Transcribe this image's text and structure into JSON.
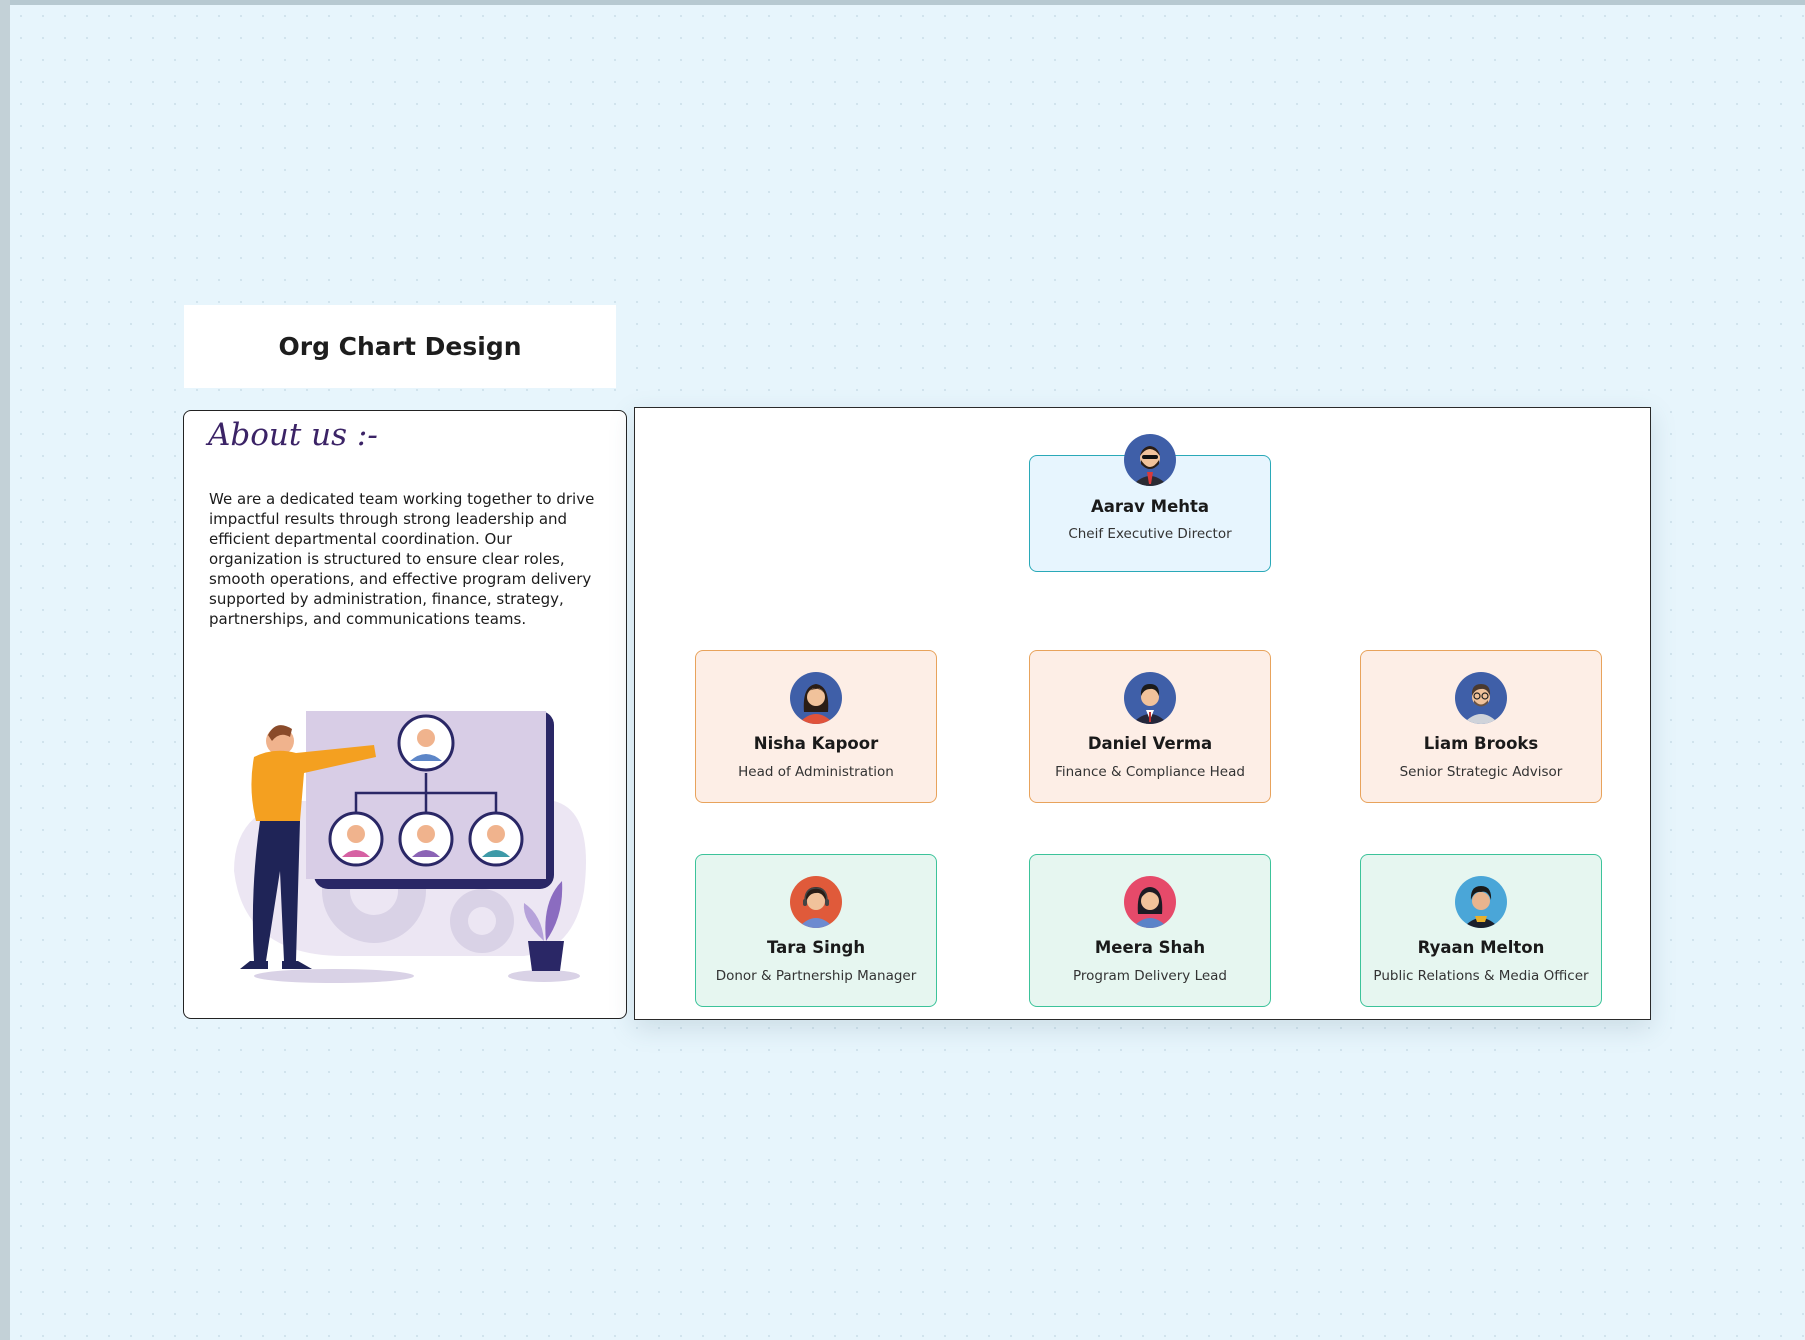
{
  "title": "Org Chart Design",
  "about": {
    "heading": "About us :-",
    "text": "We are a dedicated team working together to drive impactful results through strong leadership and efficient departmental coordination. Our organization is structured to ensure clear roles, smooth operations, and effective program delivery supported by administration, finance, strategy, partnerships, and communications teams."
  },
  "org": {
    "ceo": {
      "name": "Aarav Mehta",
      "role": "Cheif Executive Director",
      "avatar": "man-bearded-sunglasses-avatar"
    },
    "heads": [
      {
        "name": "Nisha Kapoor",
        "role": "Head of Administration",
        "avatar": "woman-avatar"
      },
      {
        "name": "Daniel Verma",
        "role": "Finance & Compliance Head",
        "avatar": "man-suit-avatar"
      },
      {
        "name": "Liam Brooks",
        "role": "Senior Strategic Advisor",
        "avatar": "man-glasses-avatar"
      }
    ],
    "staff": [
      {
        "name": "Tara Singh",
        "role": "Donor & Partnership Manager",
        "avatar": "woman-headset-avatar"
      },
      {
        "name": "Meera Shah",
        "role": "Program Delivery Lead",
        "avatar": "woman-avatar"
      },
      {
        "name": "Ryaan Melton",
        "role": "Public Relations & Media Officer",
        "avatar": "man-avatar"
      }
    ]
  },
  "colors": {
    "ceo_fill": "#e7f5fe",
    "ceo_border": "#2aa9b8",
    "head_fill": "#fdeee6",
    "head_border": "#e8a35c",
    "staff_fill": "#e6f6f0",
    "staff_border": "#3cc39a"
  }
}
